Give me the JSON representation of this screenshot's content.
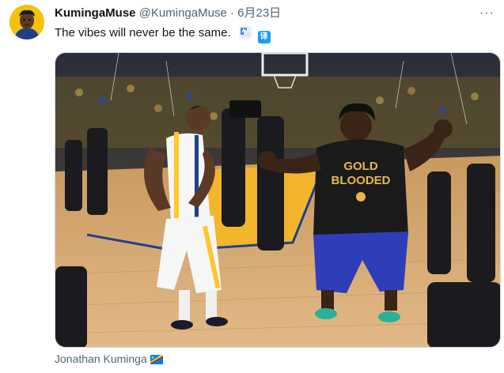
{
  "tweet": {
    "display_name": "KumingaMuse",
    "handle": "@KumingaMuse",
    "separator": "·",
    "date": "6月23日",
    "text": "The vibes will never be the same.",
    "translate_icons": [
      "google-translate-icon",
      "translate-zh-icon"
    ],
    "translate_zh_label": "译"
  },
  "media": {
    "jersey_text_line1": "GOLD",
    "jersey_text_line2": "BLOODED"
  },
  "caption": {
    "person_name": "Jonathan Kuminga",
    "flag_icon": "dr-congo-flag-icon"
  },
  "colors": {
    "warriors_blue": "#1d428a",
    "warriors_gold": "#ffc72c",
    "twitter_blue": "#1d9bf0",
    "muted_text": "#536471"
  }
}
